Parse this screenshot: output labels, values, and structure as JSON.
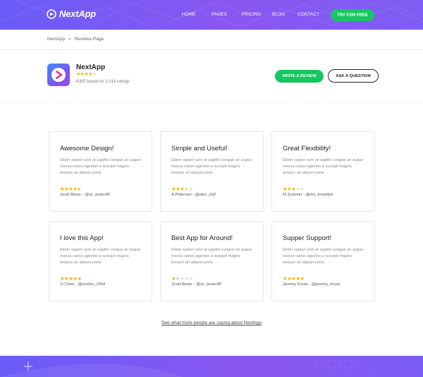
{
  "header": {
    "brand": "NextApp",
    "nav": [
      "HOME",
      "PAGES",
      "PRICING",
      "BLOG",
      "CONTACT"
    ],
    "cta": "TRY FOR FREE",
    "colors": {
      "gradient_start": "#6a5cf7",
      "gradient_end": "#8a56f0",
      "cta": "#13c85f"
    }
  },
  "breadcrumb": {
    "home": "NextApp",
    "separator": "»",
    "current": "Reviews Page"
  },
  "app": {
    "name": "NextApp",
    "stars": {
      "filled": 4,
      "total": 5
    },
    "rating_text": "4.6/5 based on 1.014 ratings",
    "write_review": "WRITE A REVIEW",
    "ask_question": "ASK A QUESTION",
    "icon": "play-logo-icon"
  },
  "reviews": [
    {
      "title": "Awesome Design!",
      "text": "Etiam sapien sem at sagittis congue an augue massa varius egestas a suscipit magna tempus an aliquet porta",
      "stars": 4.5,
      "author": "Scott Boxer - @sc_boxer96"
    },
    {
      "title": "Simple and Useful!",
      "text": "Etiam sapien sem at sagittis congue an augue massa varius egestas a suscipit magna tempus an aliquet porta",
      "stars": 3.5,
      "author": "A.Peterson - @alex_p92"
    },
    {
      "title": "Great Flexibility!",
      "text": "Etiam sapien sem at sagittis congue an augue massa varius egestas a suscipit magna tempus an aliquet porta",
      "stars": 3,
      "author": "M.Scanlon - @ms_brooklyn"
    },
    {
      "title": "I love this App!",
      "text": "Etiam sapien sem at sagittis congue an augue massa varius egestas a suscipit magna tempus an aliquet porta",
      "stars": 5,
      "author": "V.Colon - @vcolon_1994"
    },
    {
      "title": "Best App for Around!",
      "text": "Etiam sapien sem at sagittis congue an augue massa varius egestas a suscipit magna tempus an aliquet porta",
      "stars": 1.5,
      "author": "Scott Boxer - @sc_boxer96"
    },
    {
      "title": "Supper Support!",
      "text": "Etiam sapien sem at sagittis congue an augue massa varius egestas a suscipit magna tempus an aliquet porta",
      "stars": 5,
      "author": "Jeremy Kruse - @jeremy_kruse"
    }
  ],
  "more_link": "See what more people are saying about NextApp"
}
